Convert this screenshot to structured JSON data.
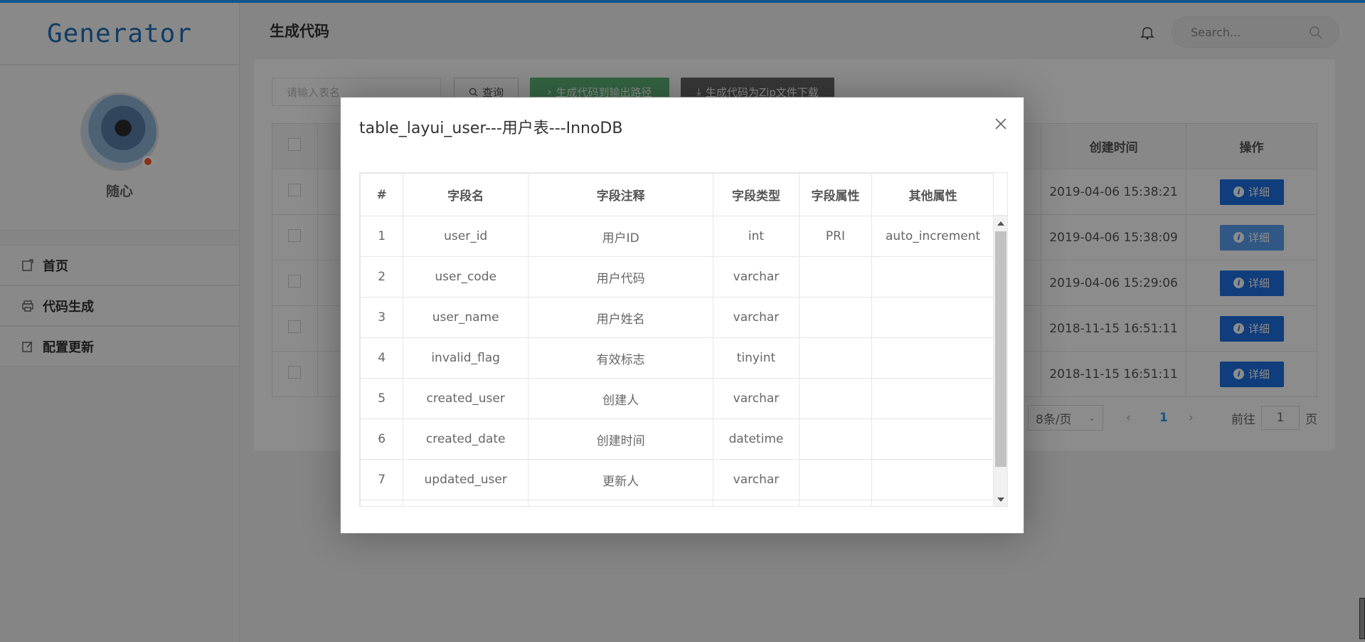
{
  "app": {
    "logo": "Generator",
    "username": "随心"
  },
  "nav": [
    {
      "label": "首页",
      "icon": "home-icon"
    },
    {
      "label": "代码生成",
      "icon": "printer-icon"
    },
    {
      "label": "配置更新",
      "icon": "edit-icon"
    }
  ],
  "header": {
    "title": "生成代码",
    "search_placeholder": "Search..."
  },
  "toolbar": {
    "table_input_placeholder": "请输入表名",
    "query_label": "查询",
    "gen_path_label": "生成代码到输出路径",
    "gen_zip_label": "生成代码为Zip文件下载"
  },
  "bg_table": {
    "headers": {
      "created_time": "创建时间",
      "action": "操作"
    },
    "rows": [
      {
        "created_time": "2019-04-06 15:38:21"
      },
      {
        "created_time": "2019-04-06 15:38:09"
      },
      {
        "created_time": "2019-04-06 15:29:06"
      },
      {
        "created_time": "2018-11-15 16:51:11"
      },
      {
        "created_time": "2018-11-15 16:51:11"
      }
    ],
    "detail_label": "详细"
  },
  "pagination": {
    "page_size": "8条/页",
    "current": "1",
    "goto_prefix": "前往",
    "goto_value": "1",
    "goto_suffix": "页"
  },
  "modal": {
    "title": "table_layui_user---用户表---InnoDB",
    "headers": [
      "#",
      "字段名",
      "字段注释",
      "字段类型",
      "字段属性",
      "其他属性"
    ],
    "rows": [
      [
        "1",
        "user_id",
        "用户ID",
        "int",
        "PRI",
        "auto_increment"
      ],
      [
        "2",
        "user_code",
        "用户代码",
        "varchar",
        "",
        ""
      ],
      [
        "3",
        "user_name",
        "用户姓名",
        "varchar",
        "",
        ""
      ],
      [
        "4",
        "invalid_flag",
        "有效标志",
        "tinyint",
        "",
        ""
      ],
      [
        "5",
        "created_user",
        "创建人",
        "varchar",
        "",
        ""
      ],
      [
        "6",
        "created_date",
        "创建时间",
        "datetime",
        "",
        ""
      ],
      [
        "7",
        "updated_user",
        "更新人",
        "varchar",
        "",
        ""
      ],
      [
        "",
        "",
        "",
        "",
        "",
        ""
      ]
    ]
  },
  "colors": {
    "accent": "#1e9fff",
    "detail_button": "#1e6fe0",
    "green_button": "#5fb878",
    "gray_button": "#666666"
  }
}
